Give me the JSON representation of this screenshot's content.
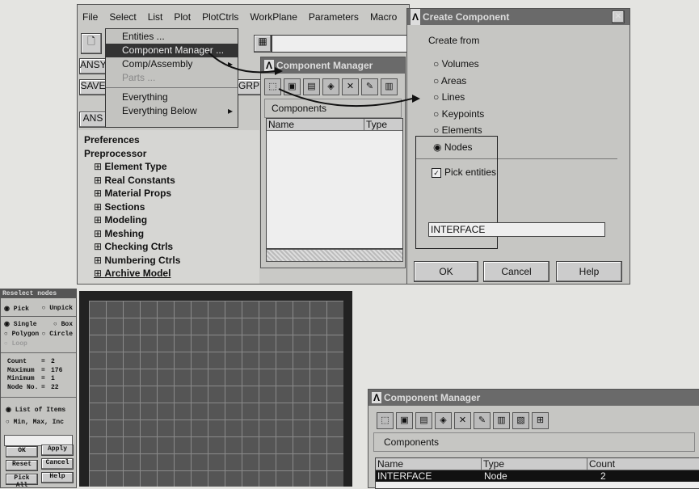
{
  "menu_bar": [
    "File",
    "Select",
    "List",
    "Plot",
    "PlotCtrls",
    "WorkPlane",
    "Parameters",
    "Macro",
    "Me"
  ],
  "toolbar_labels": {
    "ansys1": "ANSY",
    "save": "SAVE",
    "ansys2": "ANS",
    "grph": "GRPH"
  },
  "select_menu": [
    {
      "label": "Entities ...",
      "state": "normal"
    },
    {
      "label": "Component Manager ...",
      "state": "highlighted"
    },
    {
      "label": "Comp/Assembly",
      "state": "submenu"
    },
    {
      "label": "Parts ...",
      "state": "disabled"
    },
    {
      "label": "Everything",
      "state": "normal"
    },
    {
      "label": "Everything Below",
      "state": "submenu"
    }
  ],
  "tree": {
    "preferences": "Preferences",
    "preprocessor": "Preprocessor",
    "items": [
      "Element Type",
      "Real Constants",
      "Material Props",
      "Sections",
      "Modeling",
      "Meshing",
      "Checking Ctrls",
      "Numbering Ctrls",
      "Archive Model"
    ]
  },
  "comp_manager_small": {
    "title": "Component Manager",
    "components_label": "Components",
    "columns": [
      "Name",
      "Type"
    ]
  },
  "create_component": {
    "title": "Create Component",
    "create_from": "Create from",
    "options": [
      "Volumes",
      "Areas",
      "Lines",
      "Keypoints",
      "Elements",
      "Nodes"
    ],
    "selected": "Nodes",
    "pick_entities": "Pick entities",
    "pick_checked": true,
    "name_value": "INTERFACE",
    "ok": "OK",
    "cancel": "Cancel",
    "help": "Help"
  },
  "picker": {
    "title": "Reselect nodes",
    "pick": "Pick",
    "unpick": "Unpick",
    "single": "Single",
    "box": "Box",
    "polygon": "Polygon",
    "circle": "Circle",
    "loop": "Loop",
    "stats": [
      [
        "Count",
        "=",
        "2"
      ],
      [
        "Maximum",
        "=",
        "176"
      ],
      [
        "Minimum",
        "=",
        "1"
      ],
      [
        "Node No.",
        "=",
        "22"
      ]
    ],
    "list_items": "List of Items",
    "min_max_inc": "Min, Max, Inc",
    "buttons": [
      "OK",
      "Apply",
      "Reset",
      "Cancel",
      "Pick All",
      "Help"
    ]
  },
  "comp_manager_large": {
    "title": "Component Manager",
    "components_label": "Components",
    "columns": [
      "Name",
      "Type",
      "Count"
    ],
    "rows": [
      [
        "INTERFACE",
        "Node",
        "2"
      ]
    ]
  }
}
